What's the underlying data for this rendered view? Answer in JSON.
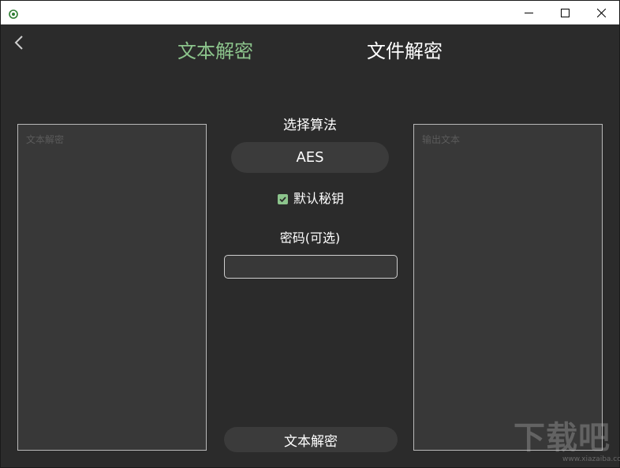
{
  "window": {
    "min_icon": "minimize-icon",
    "max_icon": "maximize-icon",
    "close_icon": "close-icon"
  },
  "nav": {
    "back_icon": "chevron-left-icon",
    "tabs": [
      {
        "label": "文本解密",
        "active": true,
        "color": "#8cc48c"
      },
      {
        "label": "文件解密",
        "active": false,
        "color": "#ffffff"
      }
    ]
  },
  "input_panel": {
    "placeholder": "文本解密",
    "value": ""
  },
  "output_panel": {
    "placeholder": "输出文本",
    "value": ""
  },
  "algorithm": {
    "label": "选择算法",
    "selected": "AES"
  },
  "default_key": {
    "label": "默认秘钥",
    "checked": true
  },
  "password": {
    "label": "密码(可选)",
    "value": ""
  },
  "action": {
    "label": "文本解密"
  },
  "watermark": {
    "text": "下载吧",
    "url": "www.xiazaiba.com"
  },
  "colors": {
    "background": "#2b2b2b",
    "panel": "#383838",
    "accent": "#8cc48c",
    "button": "#3b3b3b"
  }
}
